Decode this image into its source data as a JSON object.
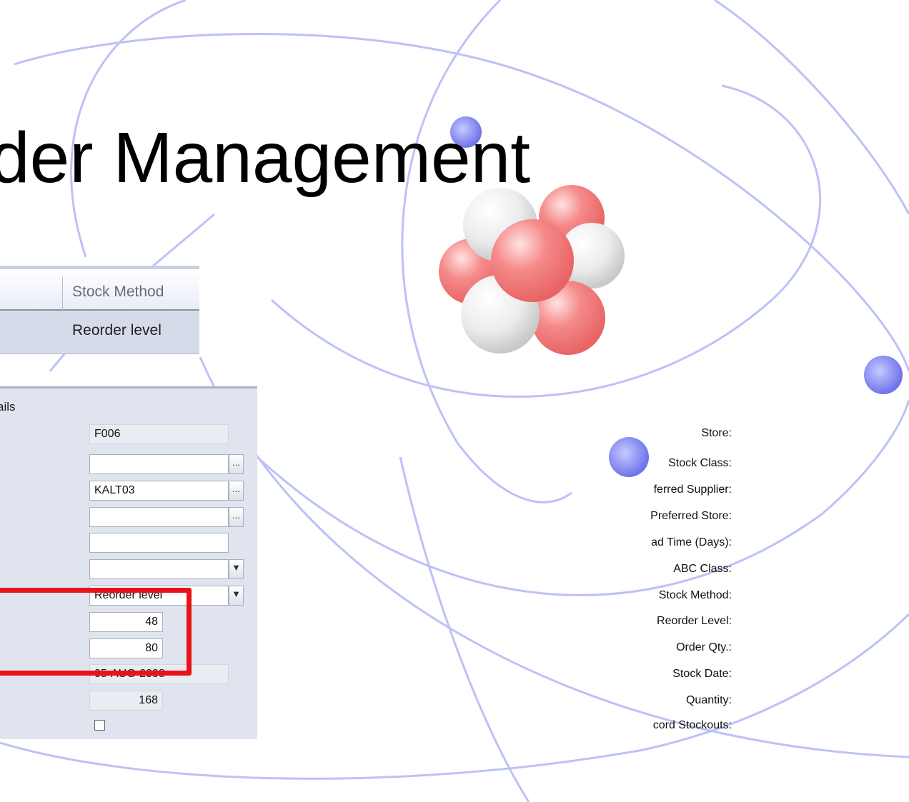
{
  "slide": {
    "title": "der Management"
  },
  "grid": {
    "column_header": "Stock Method",
    "row_value": "Reorder level"
  },
  "form": {
    "section_title": "ails",
    "fields": {
      "store": {
        "label": "Store:",
        "value": "F006"
      },
      "stock_class": {
        "label": "Stock Class:",
        "value": ""
      },
      "preferred_supplier": {
        "label": "ferred Supplier:",
        "value": "KALT03"
      },
      "preferred_store": {
        "label": "Preferred Store:",
        "value": ""
      },
      "lead_time": {
        "label": "ad Time (Days):",
        "value": ""
      },
      "abc_class": {
        "label": "ABC Class:",
        "value": ""
      },
      "stock_method": {
        "label": "Stock Method:",
        "value": "Reorder level"
      },
      "reorder_level": {
        "label": "Reorder Level:",
        "value": "48"
      },
      "order_qty": {
        "label": "Order Qty.:",
        "value": "80"
      },
      "stock_date": {
        "label": "Stock Date:",
        "value": "05-AUG-2008"
      },
      "quantity": {
        "label": "Quantity:",
        "value": "168"
      },
      "record_stockouts": {
        "label": "cord Stockouts:",
        "checked": false
      }
    },
    "lookup_button_label": "...",
    "dropdown_arrow": "▼"
  },
  "colors": {
    "highlight": "#e8121b",
    "panel_bg": "#dfe4ef",
    "orbit": "#9aa3f0",
    "atom_red": "#f07c7c",
    "electron": "#7b80ee"
  }
}
